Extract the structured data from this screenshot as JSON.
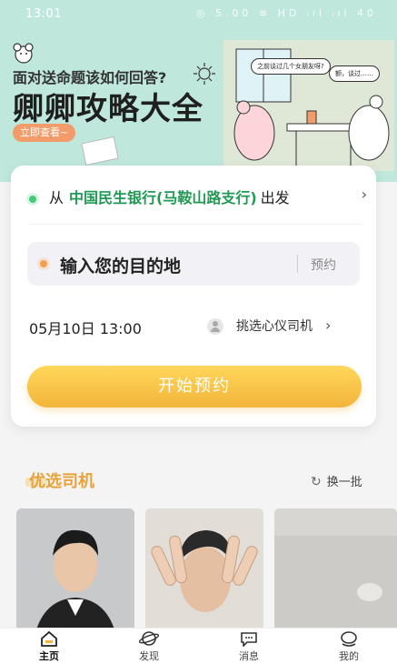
{
  "status_bar": {
    "time": "13:01",
    "icons": "◎ 5.00 ≋ HD ᵢıl ᵢıl 40"
  },
  "banner": {
    "question": "面对送命题该如何回答?",
    "title": "卿卿攻略大全",
    "cta": "立即查看~",
    "bubble_left": "之前谈过几个女朋友呀?",
    "bubble_right": "额，谈过……"
  },
  "booking": {
    "from_prefix": "从",
    "from_place": "中国民生银行(马鞍山路支行)",
    "from_suffix": "出发",
    "destination_placeholder": "输入您的目的地",
    "reserve_label": "预约",
    "datetime": "05月10日 13:00",
    "driver_choice": "挑选心仪司机",
    "start_button": "开始预约"
  },
  "drivers": {
    "section_title": "优选司机",
    "refresh_label": "换一批"
  },
  "tabs": [
    {
      "label": "主页",
      "icon": "home-icon"
    },
    {
      "label": "发现",
      "icon": "planet-icon"
    },
    {
      "label": "消息",
      "icon": "chat-icon"
    },
    {
      "label": "我的",
      "icon": "profile-icon"
    }
  ],
  "colors": {
    "banner_bg": "#bfe7dc",
    "accent_green": "#1f9a54",
    "accent_orange": "#f2b43a",
    "section_title": "#e8a23a"
  }
}
